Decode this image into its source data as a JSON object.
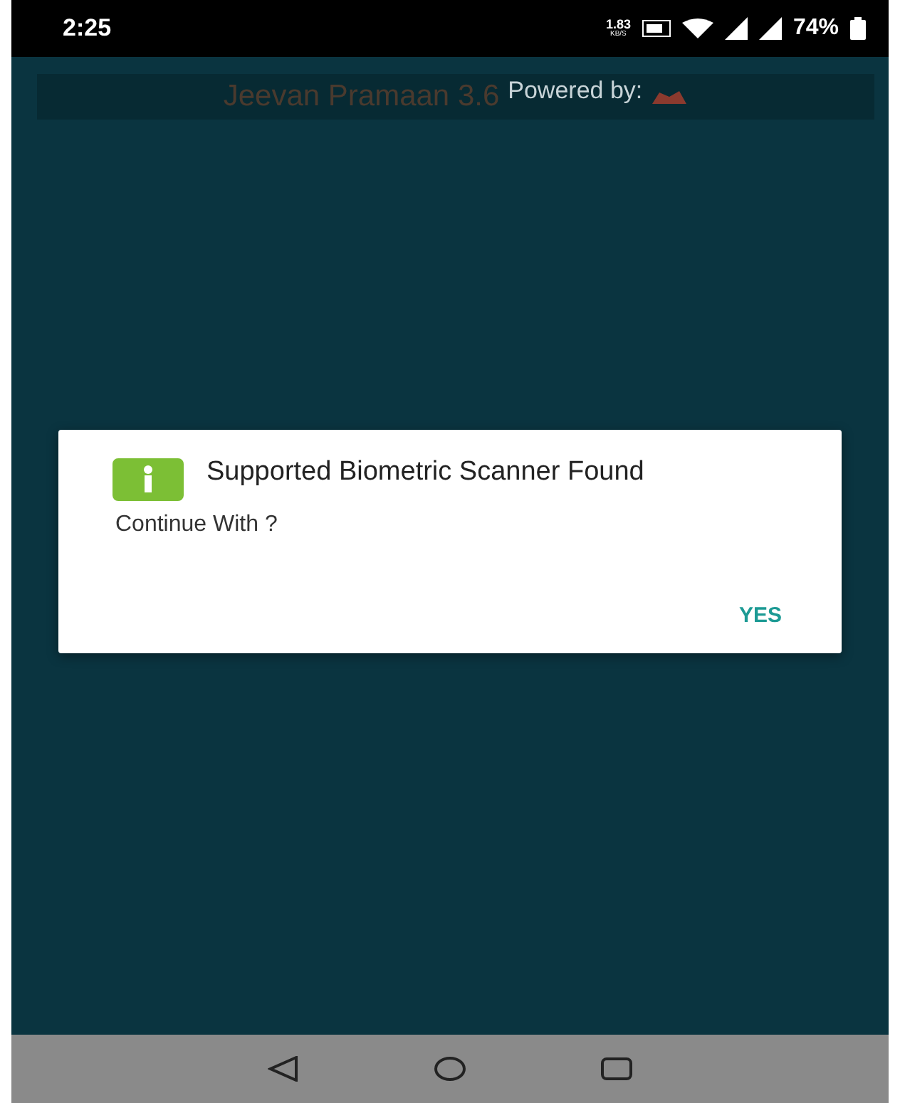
{
  "status_bar": {
    "time": "2:25",
    "speed": "1.83",
    "speed_unit": "KB/S",
    "battery": "74%"
  },
  "header": {
    "title": "Jeevan Pramaan 3.6",
    "powered_by": "Powered by:"
  },
  "dialog": {
    "title": "Supported Biometric Scanner Found",
    "message": "Continue With ?",
    "buttons": [
      "YES"
    ]
  }
}
